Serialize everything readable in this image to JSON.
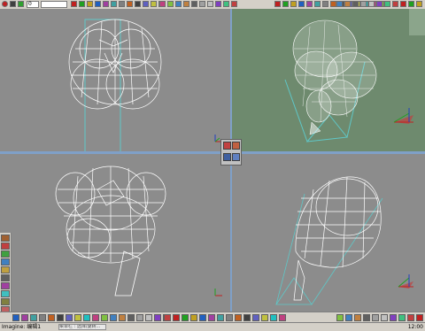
{
  "toolbar": {
    "frame_value": "0",
    "colors": [
      "#c02020",
      "#20a020",
      "#c0a020",
      "#2060c0",
      "#a040a0",
      "#40a0a0",
      "#808080",
      "#c06020",
      "#404040",
      "#6060c0",
      "#c0c040",
      "#20c0c0",
      "#c04080",
      "#80c040",
      "#4080c0",
      "#c08040",
      "#606060",
      "#a0a0a0",
      "#c0c0c0",
      "#8040c0",
      "#40c080",
      "#c04040"
    ]
  },
  "viewports": {
    "top_left": {
      "name": "front-view",
      "bg": "#8c8c8c"
    },
    "top_right": {
      "name": "perspective-view",
      "bg": "#6e8a6e"
    },
    "bottom_left": {
      "name": "top-view",
      "bg": "#8c8c8c"
    },
    "bottom_right": {
      "name": "side-view",
      "bg": "#8c8c8c"
    }
  },
  "statusbar": {
    "app_label": "Imagine: 编辑1",
    "field_text": "菜单栏 : 选择/旋转...",
    "time": "12:00"
  },
  "colors": {
    "wire": "#ffffff",
    "camera": "#5fc7c7",
    "divider": "#7fa0c8"
  }
}
